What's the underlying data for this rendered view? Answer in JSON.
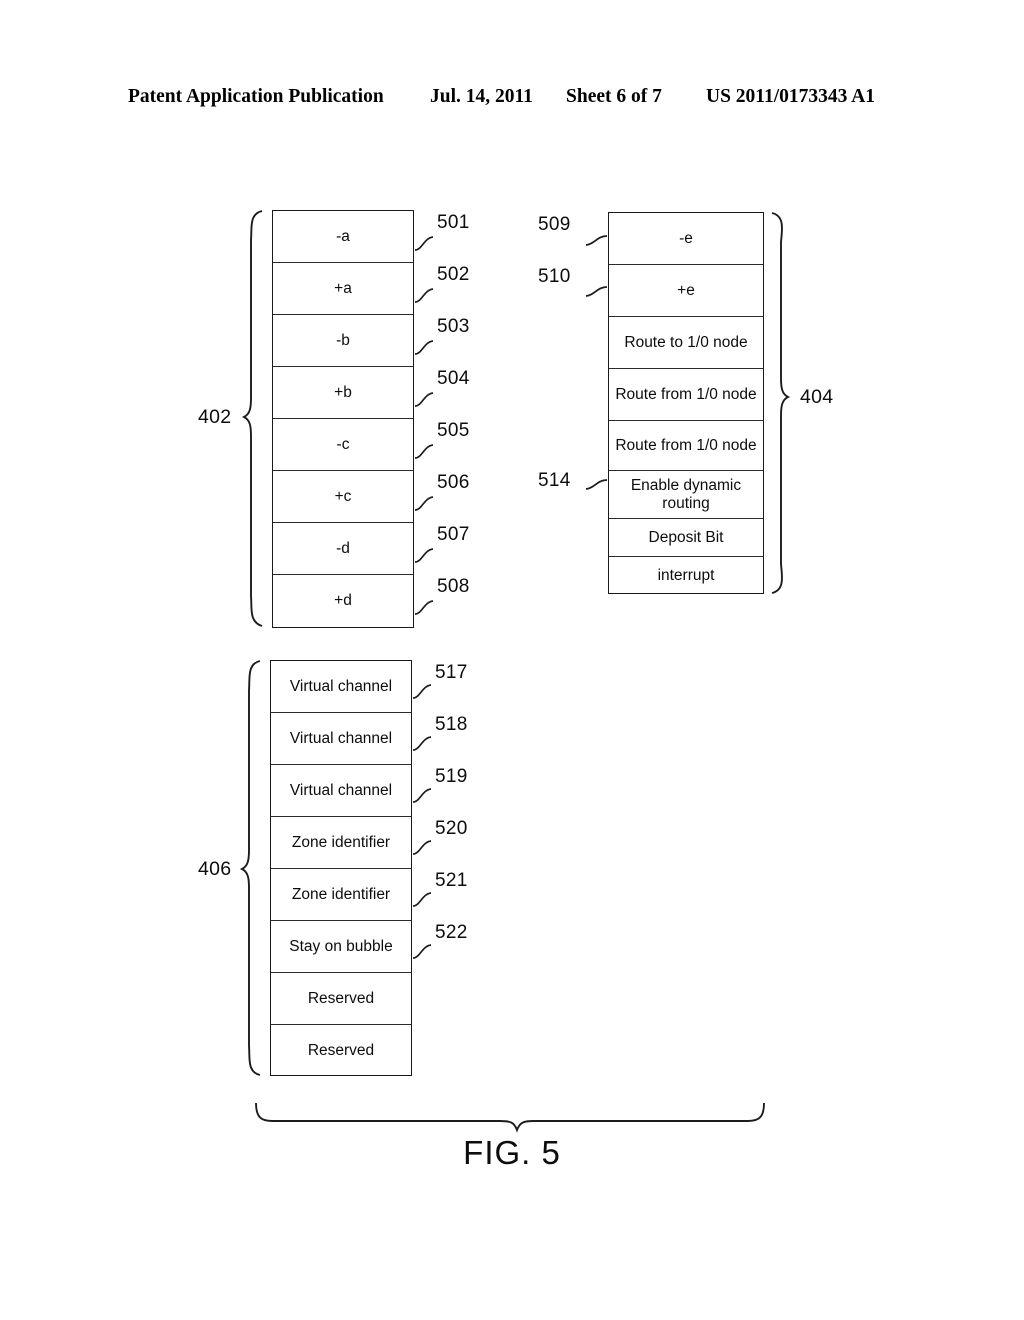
{
  "header": {
    "publication": "Patent Application Publication",
    "date": "Jul. 14, 2011",
    "sheet": "Sheet 6 of 7",
    "patent_number": "US 2011/0173343 A1"
  },
  "figure": {
    "caption": "FIG. 5"
  },
  "groups": {
    "left_top": {
      "label": "402",
      "rows": [
        {
          "text": "-a",
          "ref": "501"
        },
        {
          "text": "+a",
          "ref": "502"
        },
        {
          "text": "-b",
          "ref": "503"
        },
        {
          "text": "+b",
          "ref": "504"
        },
        {
          "text": "-c",
          "ref": "505"
        },
        {
          "text": "+c",
          "ref": "506"
        },
        {
          "text": "-d",
          "ref": "507"
        },
        {
          "text": "+d",
          "ref": "508"
        }
      ]
    },
    "right_top": {
      "label": "404",
      "rows": [
        {
          "text": "-e",
          "ref": "509"
        },
        {
          "text": "+e",
          "ref": "510"
        },
        {
          "text": "Route to 1/0 node",
          "ref": ""
        },
        {
          "text": "Route from 1/0 node",
          "ref": ""
        },
        {
          "text": "Route from 1/0 node",
          "ref": ""
        },
        {
          "text": "Enable dynamic routing",
          "ref": "514"
        },
        {
          "text": "Deposit Bit",
          "ref": ""
        },
        {
          "text": "interrupt",
          "ref": ""
        }
      ]
    },
    "left_bottom": {
      "label": "406",
      "rows": [
        {
          "text": "Virtual channel",
          "ref": "517"
        },
        {
          "text": "Virtual channel",
          "ref": "518"
        },
        {
          "text": "Virtual channel",
          "ref": "519"
        },
        {
          "text": "Zone identifier",
          "ref": "520"
        },
        {
          "text": "Zone identifier",
          "ref": "521"
        },
        {
          "text": "Stay on bubble",
          "ref": "522"
        },
        {
          "text": "Reserved",
          "ref": ""
        },
        {
          "text": "Reserved",
          "ref": ""
        }
      ]
    }
  }
}
